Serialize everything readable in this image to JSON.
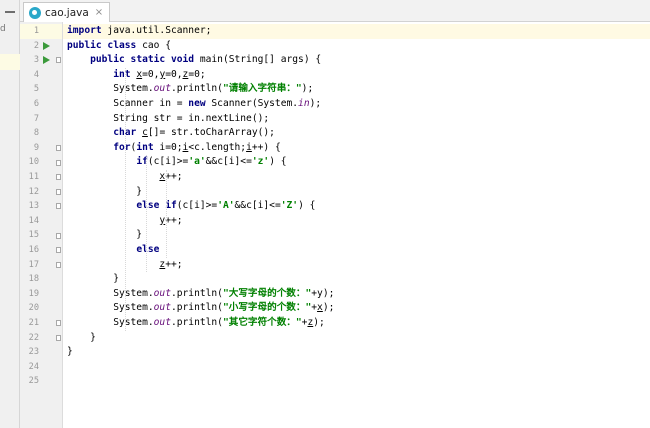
{
  "tab": {
    "filename": "cao.java",
    "close_glyph": "×"
  },
  "left_panel": {
    "fragment": "d"
  },
  "editor": {
    "current_line": 1,
    "run_lines": [
      2,
      3
    ],
    "fold_lines": [
      3,
      9,
      10,
      11,
      12,
      13,
      15,
      16,
      17,
      21,
      22
    ],
    "lines": [
      [
        {
          "t": "import",
          "c": "kw"
        },
        {
          "t": " java.util.Scanner;"
        }
      ],
      [
        {
          "t": "public class",
          "c": "kw"
        },
        {
          "t": " cao {"
        }
      ],
      [
        {
          "t": "    "
        },
        {
          "t": "public static void",
          "c": "kw"
        },
        {
          "t": " main(String[] args) {"
        }
      ],
      [
        {
          "t": "        "
        },
        {
          "t": "int",
          "c": "kw"
        },
        {
          "t": " "
        },
        {
          "t": "x",
          "c": "ul"
        },
        {
          "t": "=0,"
        },
        {
          "t": "y",
          "c": "ul"
        },
        {
          "t": "=0,"
        },
        {
          "t": "z",
          "c": "ul"
        },
        {
          "t": "=0;"
        }
      ],
      [
        {
          "t": "        System."
        },
        {
          "t": "out",
          "c": "fld"
        },
        {
          "t": ".println("
        },
        {
          "t": "\"请输入字符串：\"",
          "c": "str"
        },
        {
          "t": ");"
        }
      ],
      [
        {
          "t": "        Scanner in = "
        },
        {
          "t": "new",
          "c": "kw"
        },
        {
          "t": " Scanner(System."
        },
        {
          "t": "in",
          "c": "fld"
        },
        {
          "t": ");"
        }
      ],
      [
        {
          "t": "        String str = in.nextLine();"
        }
      ],
      [
        {
          "t": "        "
        },
        {
          "t": "char",
          "c": "kw"
        },
        {
          "t": " "
        },
        {
          "t": "c",
          "c": "ul"
        },
        {
          "t": "[]= str.toCharArray();"
        }
      ],
      [
        {
          "t": "        "
        },
        {
          "t": "for",
          "c": "kw"
        },
        {
          "t": "("
        },
        {
          "t": "int",
          "c": "kw"
        },
        {
          "t": " i=0;"
        },
        {
          "t": "i",
          "c": "ul"
        },
        {
          "t": "<c.length;"
        },
        {
          "t": "i",
          "c": "ul"
        },
        {
          "t": "++) {"
        }
      ],
      [
        {
          "t": "            "
        },
        {
          "t": "if",
          "c": "kw"
        },
        {
          "t": "(c[i]>="
        },
        {
          "t": "'a'",
          "c": "str"
        },
        {
          "t": "&&c[i]<="
        },
        {
          "t": "'z'",
          "c": "str"
        },
        {
          "t": ") {"
        }
      ],
      [
        {
          "t": "                "
        },
        {
          "t": "x",
          "c": "ul"
        },
        {
          "t": "++;"
        }
      ],
      [
        {
          "t": "            }"
        }
      ],
      [
        {
          "t": "            "
        },
        {
          "t": "else if",
          "c": "kw"
        },
        {
          "t": "(c[i]>="
        },
        {
          "t": "'A'",
          "c": "str"
        },
        {
          "t": "&&c[i]<="
        },
        {
          "t": "'Z'",
          "c": "str"
        },
        {
          "t": ") {"
        }
      ],
      [
        {
          "t": "                "
        },
        {
          "t": "y",
          "c": "ul"
        },
        {
          "t": "++;"
        }
      ],
      [
        {
          "t": "            }"
        }
      ],
      [
        {
          "t": "            "
        },
        {
          "t": "else",
          "c": "kw"
        }
      ],
      [
        {
          "t": "                "
        },
        {
          "t": "z",
          "c": "ul"
        },
        {
          "t": "++;"
        }
      ],
      [
        {
          "t": "        }"
        }
      ],
      [
        {
          "t": "        System."
        },
        {
          "t": "out",
          "c": "fld"
        },
        {
          "t": ".println("
        },
        {
          "t": "\"大写字母的个数：\"",
          "c": "str"
        },
        {
          "t": "+y);"
        }
      ],
      [
        {
          "t": "        System."
        },
        {
          "t": "out",
          "c": "fld"
        },
        {
          "t": ".println("
        },
        {
          "t": "\"小写字母的个数：\"",
          "c": "str"
        },
        {
          "t": "+"
        },
        {
          "t": "x",
          "c": "ul"
        },
        {
          "t": ");"
        }
      ],
      [
        {
          "t": "        System."
        },
        {
          "t": "out",
          "c": "fld"
        },
        {
          "t": ".println("
        },
        {
          "t": "\"其它字符个数：\"",
          "c": "str"
        },
        {
          "t": "+"
        },
        {
          "t": "z",
          "c": "ul"
        },
        {
          "t": ");"
        }
      ],
      [
        {
          "t": "    }"
        }
      ],
      [
        {
          "t": "}"
        }
      ],
      [],
      []
    ]
  }
}
